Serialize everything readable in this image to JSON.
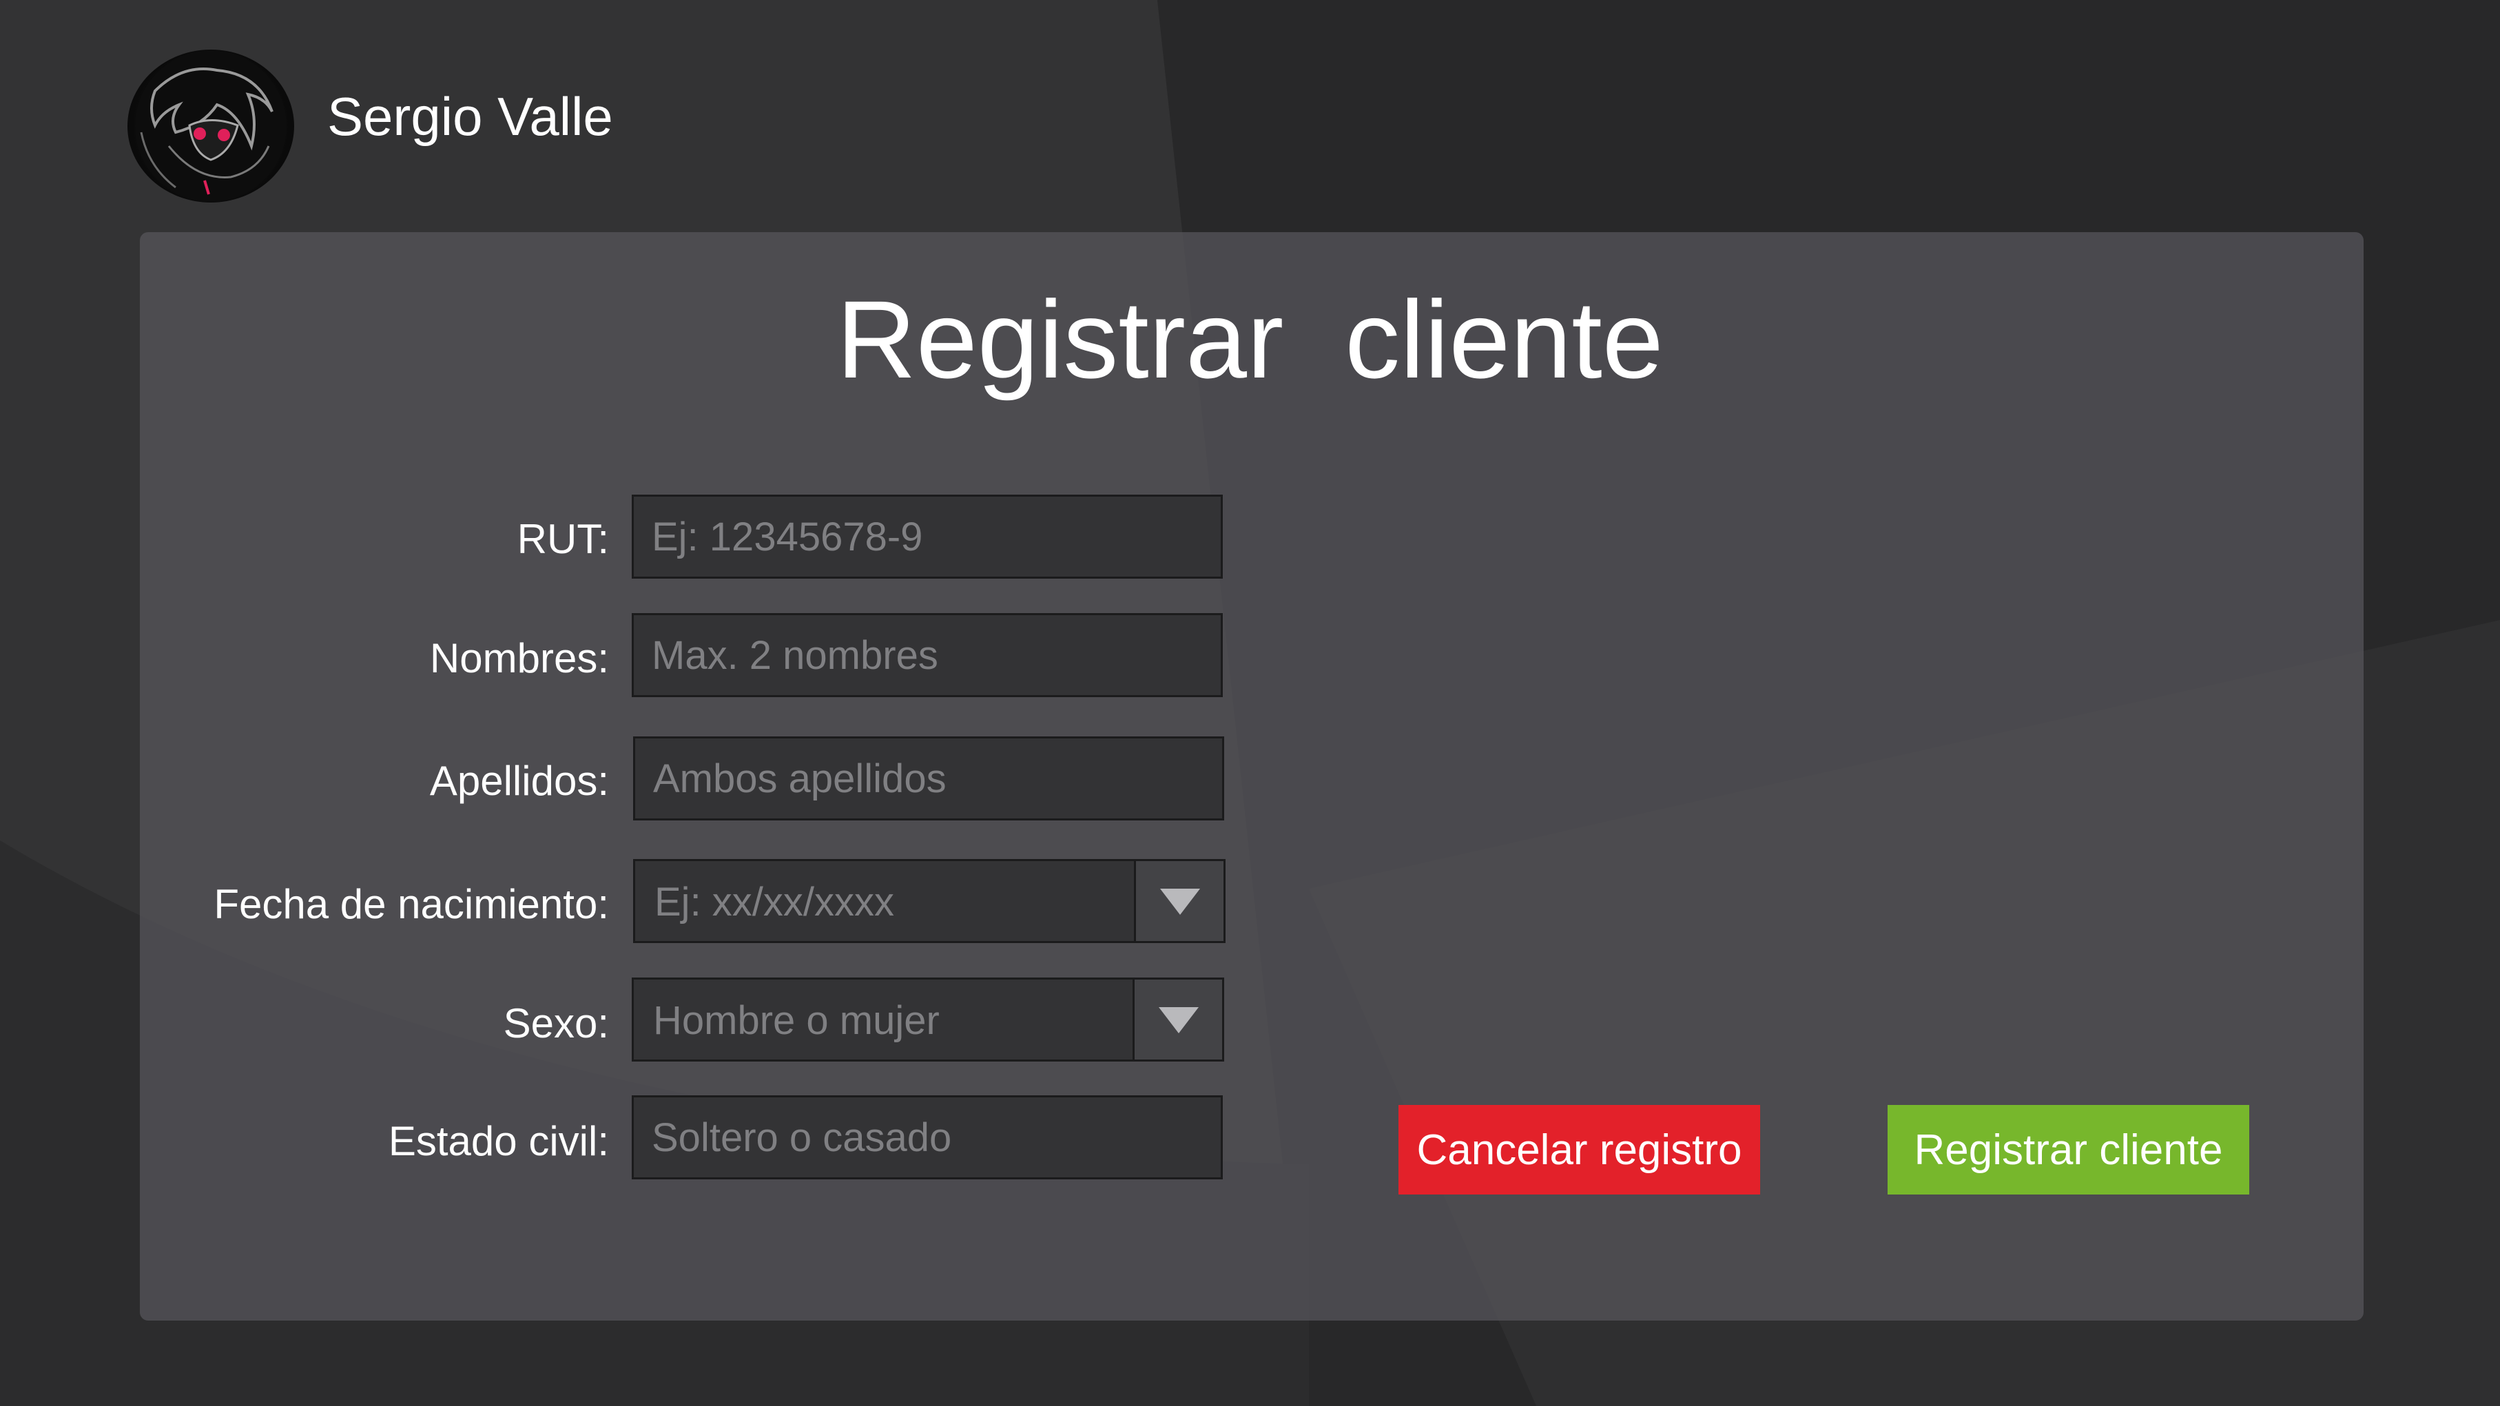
{
  "header": {
    "user_name": "Sergio Valle",
    "avatar_icon": "anime-avatar-icon"
  },
  "form": {
    "title": "Registrar  cliente",
    "fields": {
      "rut": {
        "label": "RUT:",
        "placeholder": "Ej: 12345678-9"
      },
      "nombres": {
        "label": "Nombres:",
        "placeholder": "Max. 2 nombres"
      },
      "apellidos": {
        "label": "Apellidos:",
        "placeholder": "Ambos apellidos"
      },
      "fecha": {
        "label": "Fecha de nacimiento:",
        "placeholder": "Ej: xx/xx/xxxx"
      },
      "sexo": {
        "label": "Sexo:",
        "placeholder": "Hombre o mujer"
      },
      "estado_civil": {
        "label": "Estado civil:",
        "placeholder": "Soltero o casado"
      }
    },
    "buttons": {
      "cancel": "Cancelar registro",
      "register": "Registrar cliente"
    }
  },
  "colors": {
    "cancel": "#e3212a",
    "register": "#77b72c",
    "panel": "#545358",
    "background": "#2b2b2c"
  }
}
